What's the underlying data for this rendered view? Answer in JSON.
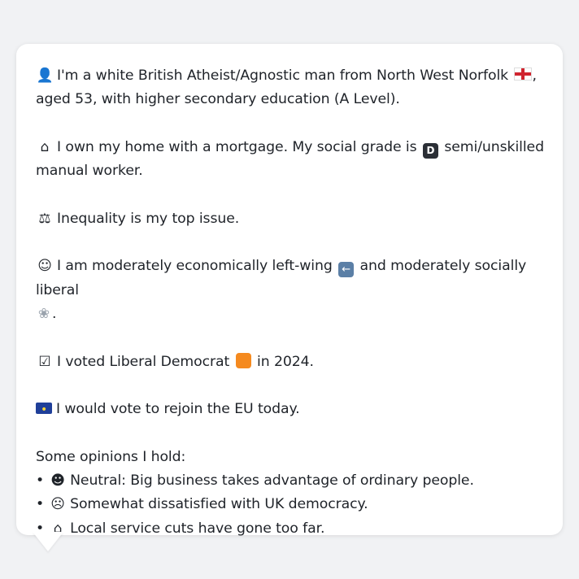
{
  "card": {
    "identity": {
      "icon": "person-silhouette-icon",
      "text_1": "I'm a white British Atheist/Agnostic man from North West Norfolk",
      "flag": "england-flag-icon",
      "text_2": ",",
      "text_3": "aged 53, with higher secondary education (A Level)."
    },
    "home": {
      "icon": "house-icon",
      "text_1": "I own my home with a mortgage. My social grade is",
      "grade_letter": "D",
      "text_2": "semi/unskilled",
      "text_3": "manual worker."
    },
    "issue": {
      "icon": "scales-icon",
      "text": "Inequality is my top issue."
    },
    "ideology": {
      "icon": "thinking-face-icon",
      "text_1": "I am moderately economically left-wing",
      "left_arrow_icon": "left-arrow-icon",
      "text_2": "and moderately socially liberal",
      "dove_icon": "dove-icon",
      "text_3": "."
    },
    "vote": {
      "icon": "ballot-box-icon",
      "text_1": "I voted Liberal Democrat",
      "party_color": "#f58a1f",
      "text_2": "in 2024."
    },
    "eu": {
      "icon": "eu-flag-icon",
      "text": "I would vote to rejoin the EU today."
    },
    "opinions": {
      "heading": "Some opinions I hold:",
      "items": [
        {
          "bullet": "•",
          "icon": "neutral-face-icon",
          "text": "Neutral: Big business takes advantage of ordinary people."
        },
        {
          "bullet": "•",
          "icon": "confused-face-icon",
          "text": "Somewhat dissatisfied with UK democracy."
        },
        {
          "bullet": "•",
          "icon": "derelict-house-icon",
          "text": "Local service cuts have gone too far."
        }
      ]
    }
  }
}
